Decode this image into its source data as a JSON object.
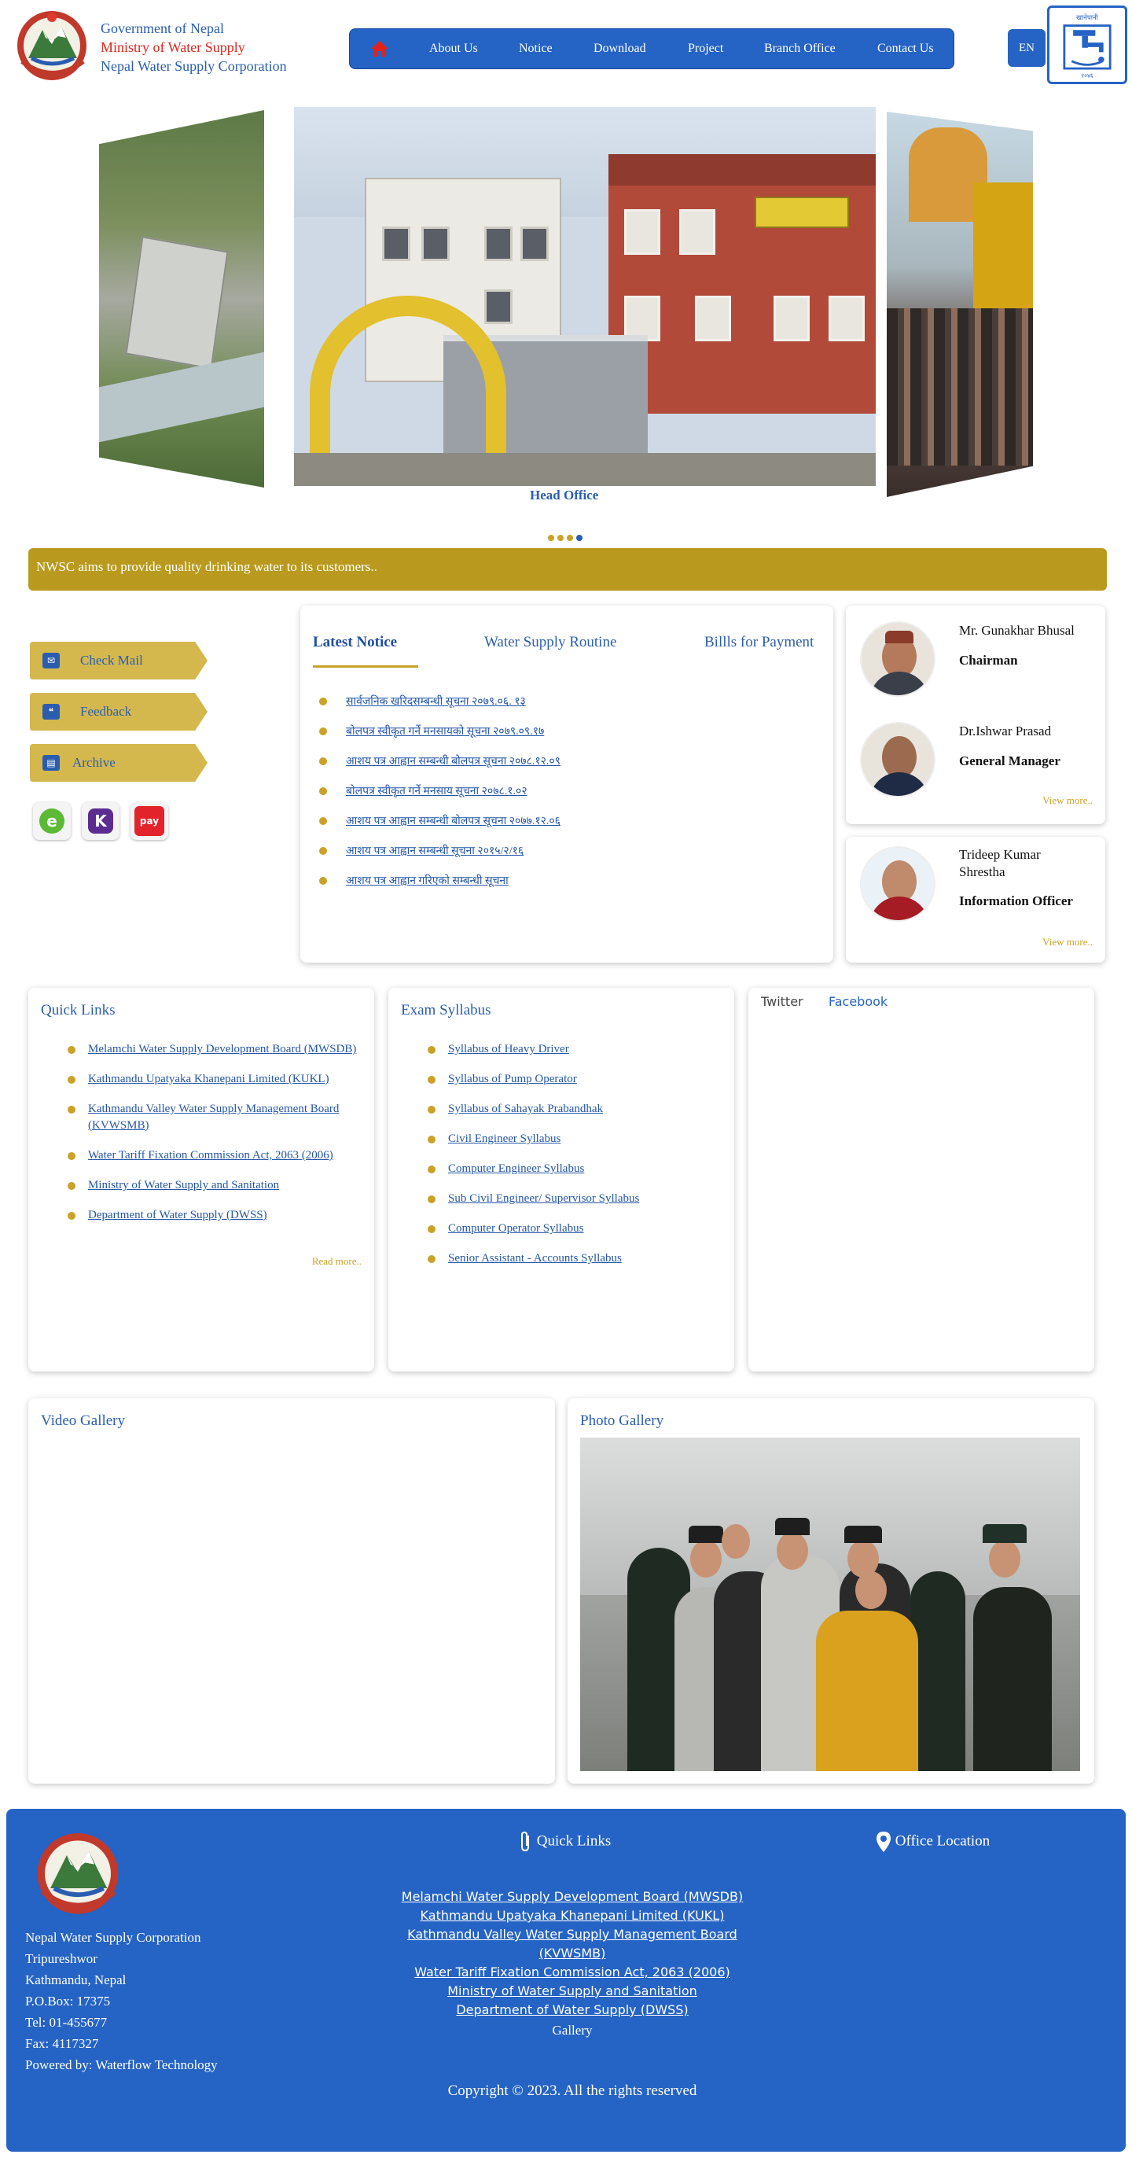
{
  "header": {
    "gov_line1": "Government of Nepal",
    "gov_line2": "Ministry of Water Supply",
    "gov_line3": "Nepal Water Supply Corporation",
    "nav": [
      "About Us",
      "Notice",
      "Download",
      "Project",
      "Branch Office",
      "Contact Us"
    ],
    "lang": "EN",
    "logo_text_top": "खानेपानी",
    "logo_text_bottom": "२०४६"
  },
  "slider": {
    "main_caption": "Head Office",
    "left_caption": "",
    "right_caption": "",
    "slide_count": 4,
    "active_slide": 4
  },
  "marquee": "NWSC aims to provide quality drinking water to its customers..",
  "side_buttons": [
    {
      "label": "Check Mail",
      "icon": "mail-icon"
    },
    {
      "label": "Feedback",
      "icon": "feedback-icon"
    },
    {
      "label": "Archive",
      "icon": "archive-icon"
    }
  ],
  "payment_icons": [
    "esewa-icon",
    "khalti-icon",
    "imepay-icon"
  ],
  "notice": {
    "tabs": [
      "Latest Notice",
      "Water Supply Routine",
      "Billls for Payment"
    ],
    "items": [
      "सार्वजनिक खरिदसम्बन्धी सूचना २०७९.०६. १३",
      "बोलपत्र स्वीकृत गर्ने मनसायको सूचना २०७९.०९.१७",
      "आशय पत्र आह्वान सम्बन्धी बोलपत्र सूचना २०७८.१२.०९",
      "बोलपत्र स्वीकृत गर्ने मनसाय सूचना २०७८.१.०२",
      "आशय पत्र आह्वान सम्बन्धी बोलपत्र सूचना २०७७.१२.०६",
      "आशय पत्र आह्वान सम्बन्धी सूचना २०१५/२/१६",
      "आशय पत्र आह्वान गरिएको सम्बन्धी सूचना"
    ]
  },
  "officers": [
    {
      "name": "Mr. Gunakhar Bhusal",
      "role": "Chairman"
    },
    {
      "name": "Dr.Ishwar Prasad",
      "role": "General Manager"
    },
    {
      "name": "Trideep Kumar Shrestha",
      "role": "Information Officer"
    }
  ],
  "view_more": "View more..",
  "quick_links": {
    "title": "Quick Links",
    "items": [
      "Melamchi Water Supply Development Board (MWSDB)",
      "Kathmandu Upatyaka Khanepani Limited (KUKL)",
      "Kathmandu Valley Water Supply Management Board (KVWSMB)",
      "Water Tariff Fixation Commission Act, 2063 (2006)",
      "Ministry of Water Supply and Sanitation",
      "Department of Water Supply (DWSS)"
    ],
    "read_more": "Read more.."
  },
  "exam_syllabus": {
    "title": "Exam Syllabus",
    "items": [
      "Syllabus of Heavy Driver",
      "Syllabus of Pump Operator",
      "Syllabus of Sahayak Prabandhak",
      "Civil Engineer Syllabus",
      "Computer Engineer Syllabus",
      "Sub Civil Engineer/ Supervisor Syllabus",
      "Computer Operator Syllabus",
      "Senior Assistant - Accounts Syllabus"
    ]
  },
  "social": {
    "twitter": "Twitter",
    "facebook": "Facebook"
  },
  "video_gallery": "Video Gallery",
  "photo_gallery": "Photo Gallery",
  "footer": {
    "address": [
      "Nepal Water Supply Corporation",
      "Tripureshwor",
      "Kathmandu, Nepal",
      "P.O.Box: 17375",
      "Tel: 01-455677",
      "Fax: 4117327",
      "Powered by: Waterflow Technology"
    ],
    "quick_links_title": "Quick Links",
    "office_location_title": "Office Location",
    "links": [
      "Melamchi Water Supply Development Board (MWSDB)",
      "Kathmandu Upatyaka Khanepani Limited (KUKL)",
      "Kathmandu Valley Water Supply Management Board (KVWSMB)",
      "Water Tariff Fixation Commission Act, 2063 (2006)",
      "Ministry of Water Supply and Sanitation",
      "Department of Water Supply (DWSS)"
    ],
    "gallery": "Gallery",
    "copyright": "Copyright © 2023. All the rights reserved"
  },
  "colors": {
    "primary_blue": "#2563c4",
    "gold": "#c9a227",
    "marquee_gold": "#b99a1e",
    "ministry_red": "#e0241b"
  }
}
